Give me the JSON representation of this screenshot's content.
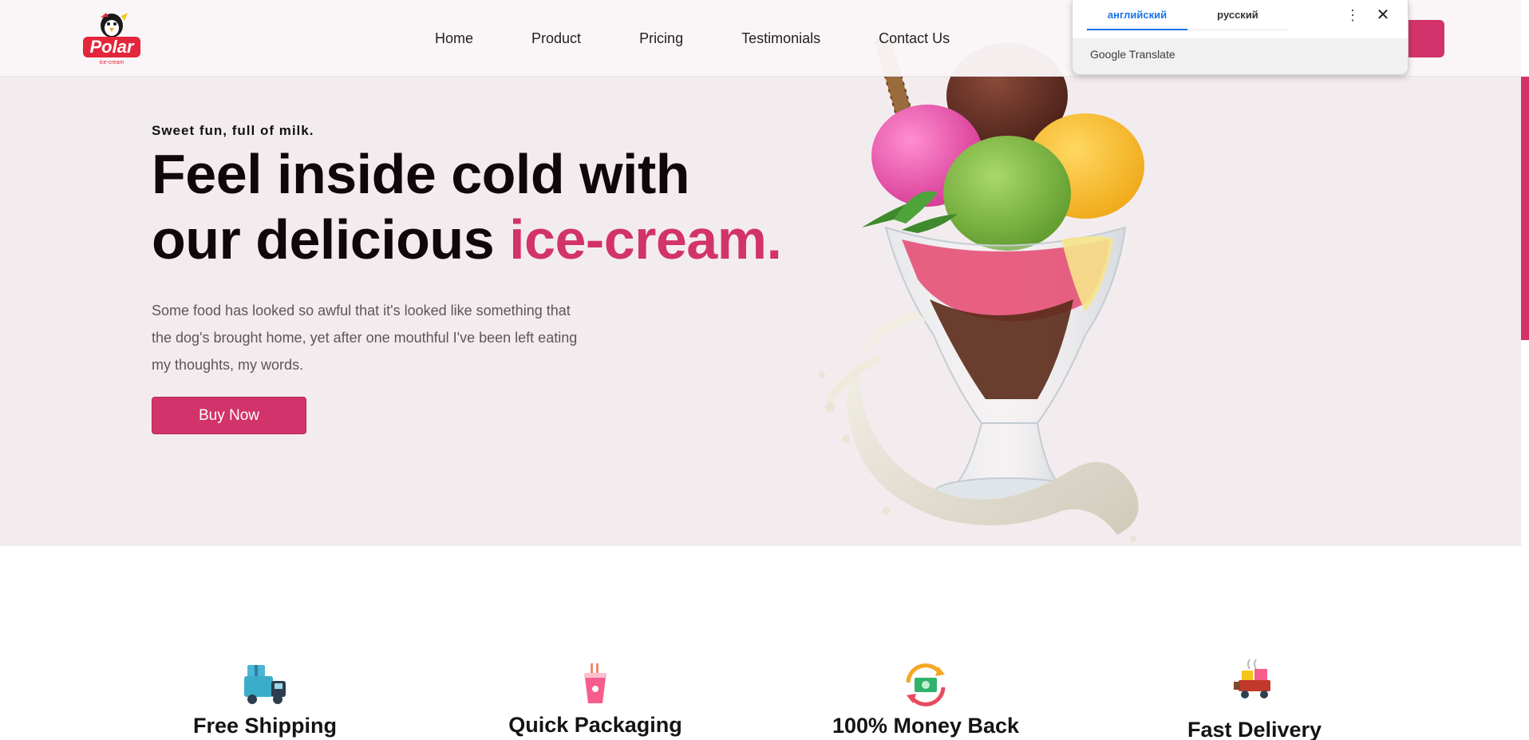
{
  "nav": {
    "logo_text": "Polar",
    "logo_subtext": "ice-cream",
    "links": [
      "Home",
      "Product",
      "Pricing",
      "Testimonials",
      "Contact Us"
    ]
  },
  "hero": {
    "tagline": "Sweet fun, full of milk.",
    "headline_line1": "Feel inside cold with",
    "headline_line2_prefix": "our delicious ",
    "headline_accent": "ice-cream.",
    "description": "Some food has looked so awful that it's looked like something that the dog's brought home, yet after one mouthful I've been left eating my thoughts, my words.",
    "buy_label": "Buy Now"
  },
  "features": [
    {
      "title": "Free Shipping",
      "icon": "delivery-truck-icon"
    },
    {
      "title": "Quick Packaging",
      "icon": "drink-cup-icon"
    },
    {
      "title": "100% Money Back",
      "icon": "money-refund-icon"
    },
    {
      "title": "Fast Delivery",
      "icon": "delivery-cart-icon"
    }
  ],
  "translate_popup": {
    "tab_source": "английский",
    "tab_target": "русский",
    "brand": "Google",
    "brand_suffix": "Translate",
    "menu_icon": "more-vertical-icon",
    "close_icon": "close-icon"
  },
  "colors": {
    "accent": "#d2336a",
    "hero_bg": "#f3ecee",
    "headline": "#120708",
    "translate_blue": "#1a73e8"
  }
}
